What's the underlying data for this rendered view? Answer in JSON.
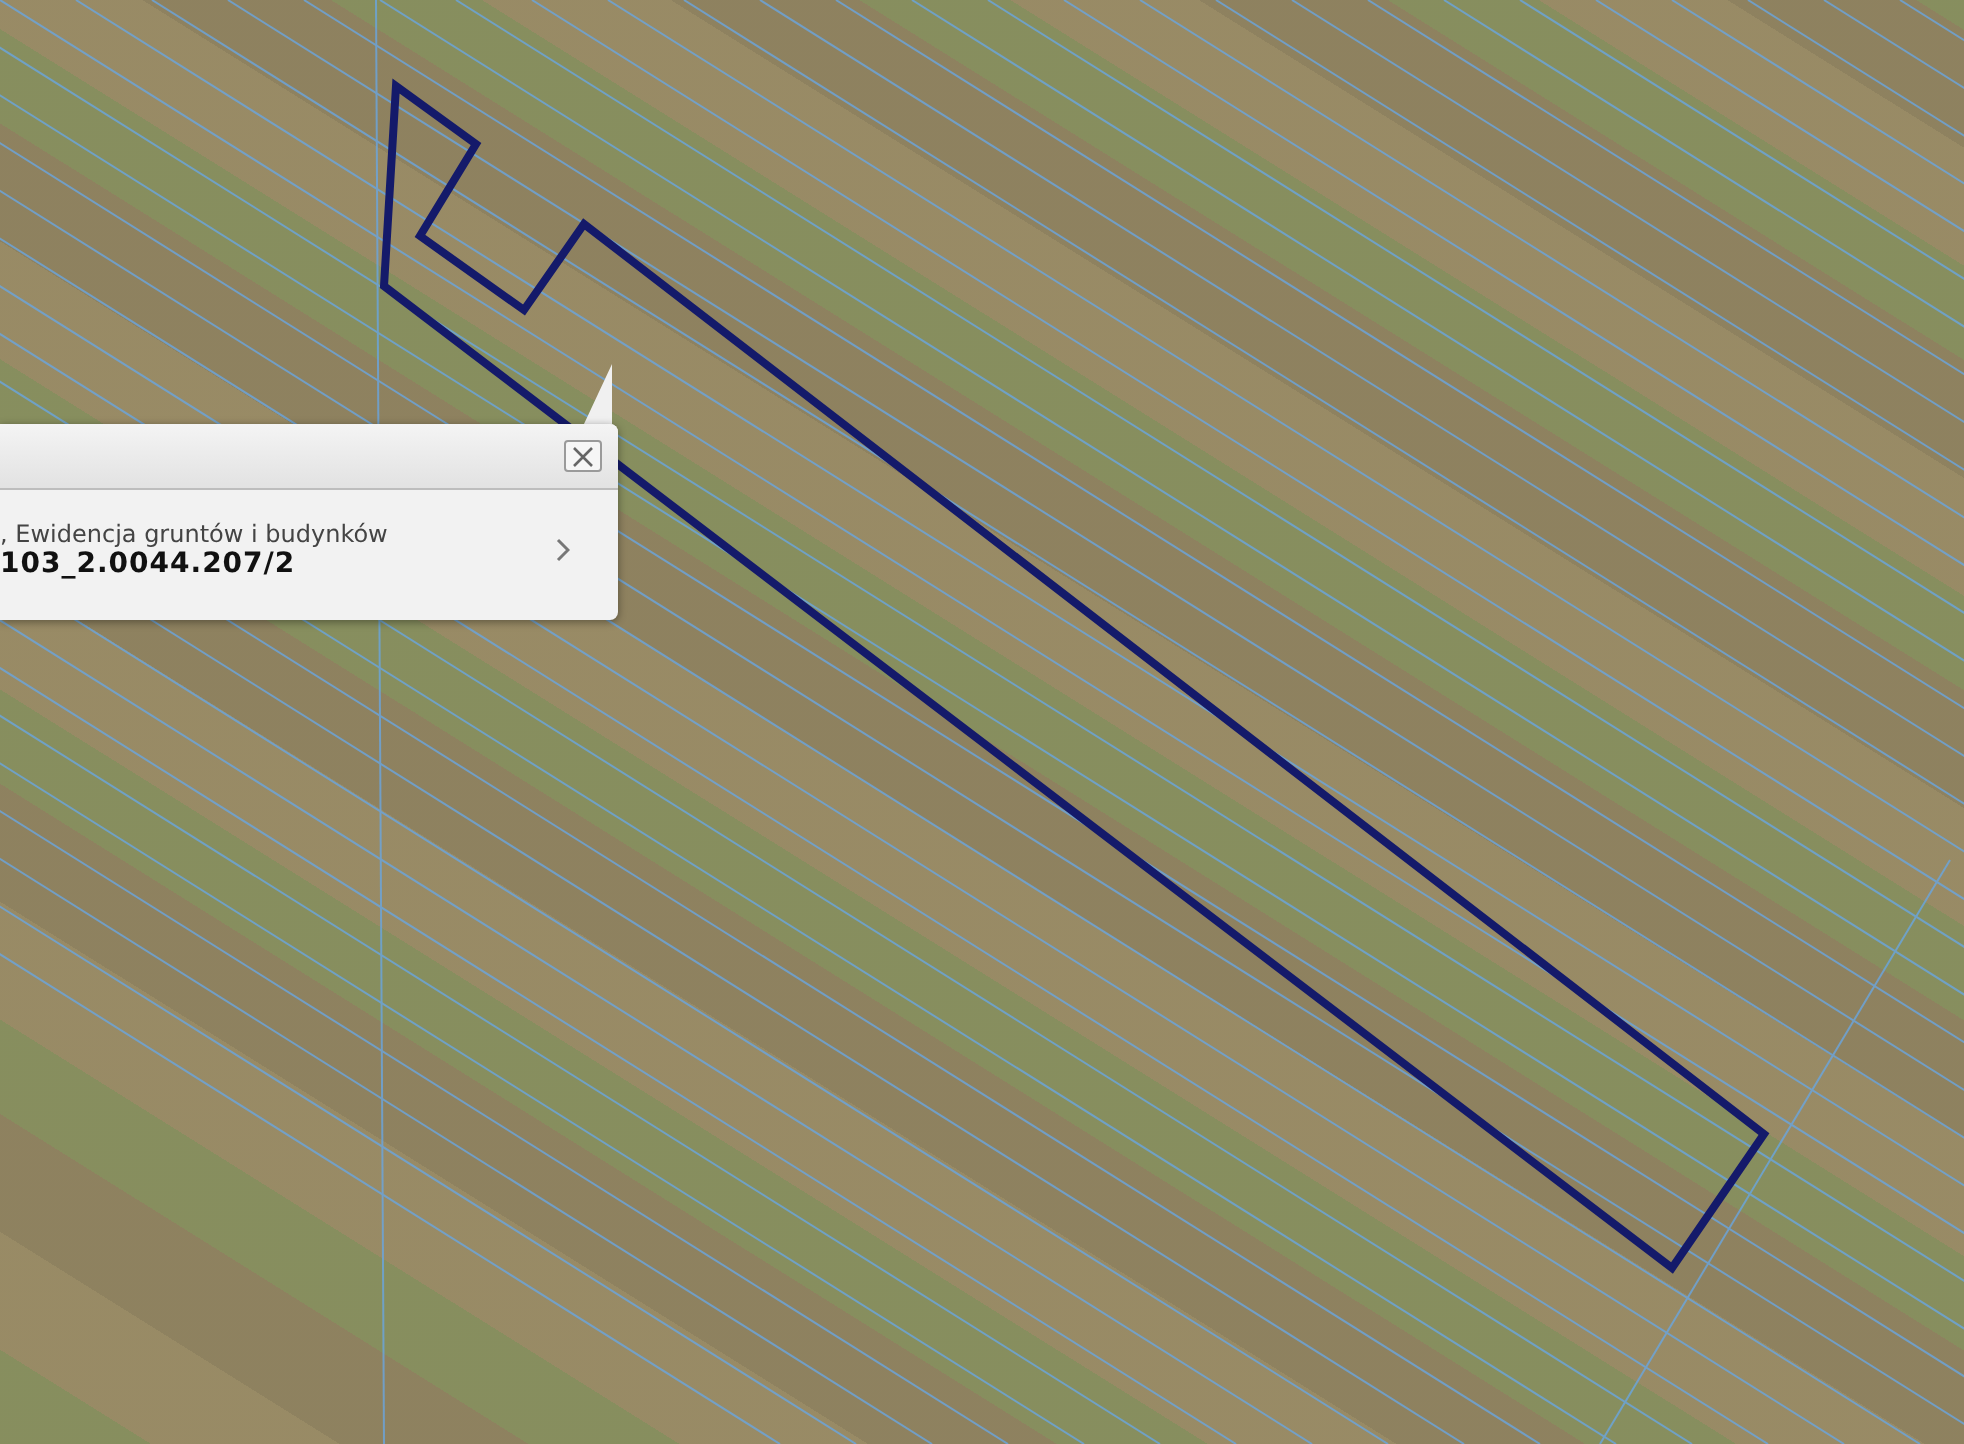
{
  "popup": {
    "layer": ", Ewidencja gruntów i budynków",
    "parcel_id": "103_2.0044.207/2"
  }
}
